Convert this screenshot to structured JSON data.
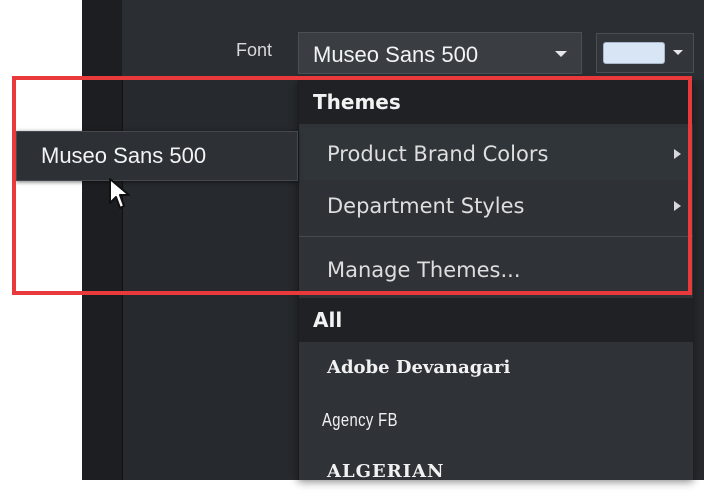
{
  "toolbar": {
    "font_label": "Font",
    "font_value": "Museo Sans 500",
    "color_swatch": "#d8e5f5"
  },
  "menu": {
    "themes_header": "Themes",
    "items": [
      {
        "label": "Product Brand Colors",
        "has_submenu": true
      },
      {
        "label": "Department Styles",
        "has_submenu": true
      },
      {
        "label": "Manage Themes...",
        "has_submenu": false
      }
    ],
    "all_header": "All",
    "fonts": [
      "Adobe Devanagari",
      "Agency FB",
      "ALGERIAN"
    ]
  },
  "preview": {
    "label": "Museo Sans 500"
  },
  "colors": {
    "highlight": "#e83a3a",
    "panel_bg": "#26292d",
    "menu_bg": "#2f3338",
    "section_bg": "#1f2125",
    "text": "#f1f3f5"
  },
  "icons": {
    "font_dropdown": "chevron-down-icon",
    "color_dropdown": "chevron-down-icon",
    "submenu": "chevron-right-icon",
    "cursor": "mouse-pointer-icon"
  }
}
